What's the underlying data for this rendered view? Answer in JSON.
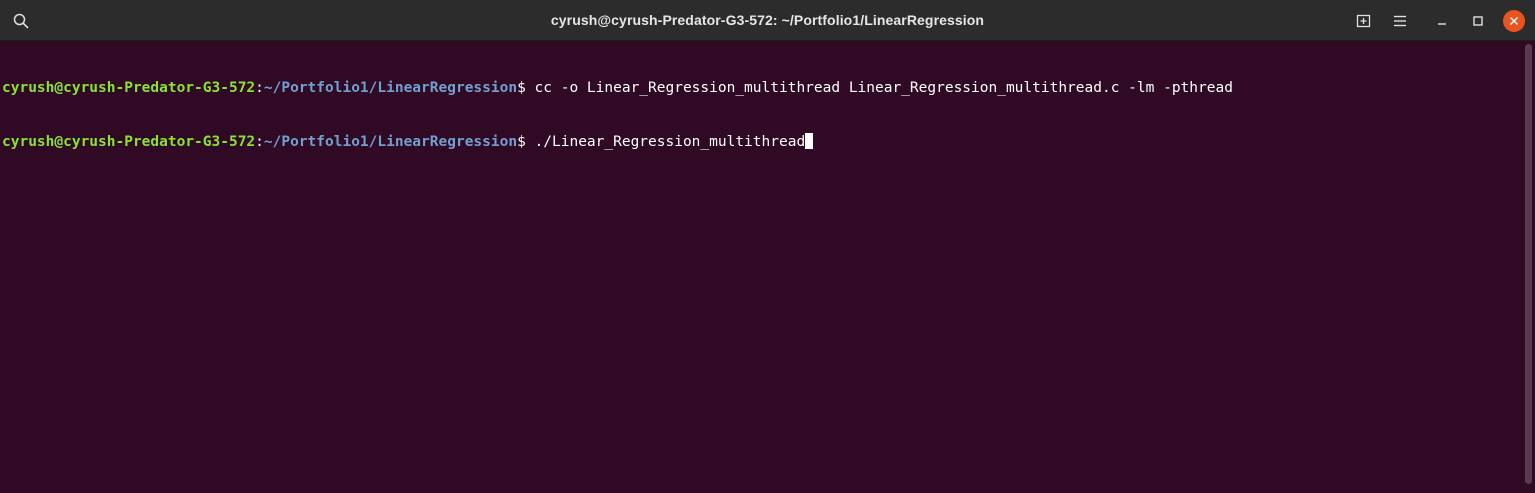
{
  "window": {
    "title": "cyrush@cyrush-Predator-G3-572: ~/Portfolio1/LinearRegression"
  },
  "titlebar": {
    "icons": {
      "search": "search-icon",
      "new_tab": "new-tab-icon",
      "menu": "hamburger-menu-icon",
      "minimize": "minimize-icon",
      "maximize": "maximize-icon",
      "close": "close-icon"
    }
  },
  "terminal": {
    "lines": [
      {
        "user": "cyrush@cyrush-Predator-G3-572",
        "colon": ":",
        "path": "~/Portfolio1/LinearRegression",
        "dollar": "$ ",
        "command": "cc -o Linear_Regression_multithread Linear_Regression_multithread.c -lm -pthread"
      },
      {
        "user": "cyrush@cyrush-Predator-G3-572",
        "colon": ":",
        "path": "~/Portfolio1/LinearRegression",
        "dollar": "$ ",
        "command": "./Linear_Regression_multithread"
      }
    ]
  },
  "colors": {
    "background": "#300a24",
    "titlebar": "#2c2c2c",
    "user": "#8ae234",
    "path": "#729fcf",
    "close_button": "#e95420"
  }
}
